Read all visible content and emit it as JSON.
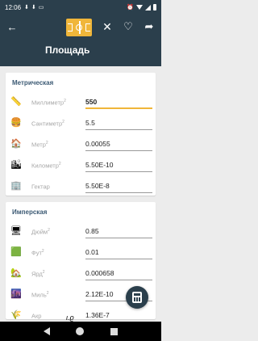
{
  "status_bar": {
    "time": "12:06",
    "icons": [
      "download-icon",
      "download-icon",
      "clipboard-icon",
      "alarm-icon",
      "wifi-icon",
      "signal-icon",
      "battery-icon"
    ]
  },
  "toolbar": {
    "title": "Площадь",
    "category_icon": "soccer-field-icon",
    "back_glyph": "←",
    "close_glyph": "✕",
    "favorite_glyph": "♡",
    "share_glyph": "➦"
  },
  "sections": [
    {
      "title": "Метрическая",
      "rows": [
        {
          "icon": "ruler-icon",
          "glyph": "📏",
          "label": "Миллиметр",
          "sup": "2",
          "value": "550",
          "active": true
        },
        {
          "icon": "hamburger-icon",
          "glyph": "🍔",
          "label": "Сантиметр",
          "sup": "2",
          "value": "5.5",
          "active": false
        },
        {
          "icon": "house-icon",
          "glyph": "🏠",
          "label": "Метр",
          "sup": "2",
          "value": "0.00055",
          "active": false
        },
        {
          "icon": "city-icon",
          "glyph": "🏙",
          "label": "Километр",
          "sup": "2",
          "value": "5.50E-10",
          "active": false
        },
        {
          "icon": "building-icon",
          "glyph": "🏢",
          "label": "Гектар",
          "sup": "",
          "value": "5.50E-8",
          "active": false
        }
      ]
    },
    {
      "title": "Имперская",
      "rows": [
        {
          "icon": "monitor-icon",
          "glyph": "🖥",
          "label": "Дюйм",
          "sup": "2",
          "value": "0.85",
          "active": false
        },
        {
          "icon": "carpet-icon",
          "glyph": "🟩",
          "label": "Фут",
          "sup": "2",
          "value": "0.01",
          "active": false
        },
        {
          "icon": "house-garden-icon",
          "glyph": "🏡",
          "label": "Ярд",
          "sup": "2",
          "value": "0.000658",
          "active": false
        },
        {
          "icon": "city-icon",
          "glyph": "🌆",
          "label": "Миль",
          "sup": "2",
          "value": "2.12E-10",
          "active": false
        },
        {
          "icon": "field-icon",
          "glyph": "🌾",
          "label": "Акр",
          "sup": "",
          "value": "1.36E-7",
          "active": false
        }
      ]
    }
  ],
  "fab": {
    "icon": "calculator-icon"
  },
  "handwriting": "ι.ϱ"
}
